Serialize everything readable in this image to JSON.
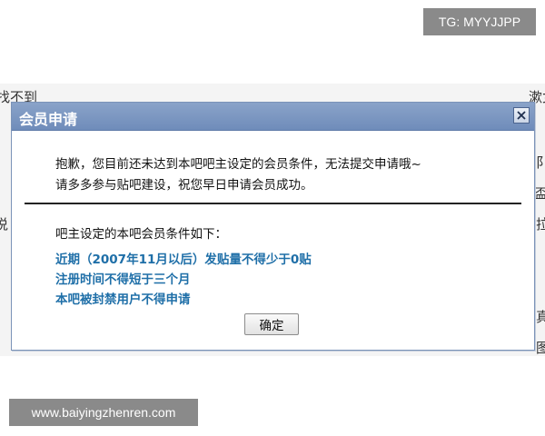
{
  "background": {
    "left_top_text": "找不到",
    "left_mid_text": "说",
    "right_top_text": "漱女",
    "right_fragments": [
      "阝",
      "盃",
      "拉",
      "真",
      "图"
    ]
  },
  "dialog": {
    "title": "会员申请",
    "close_glyph": "✕",
    "message_line1": "抱歉，您目前还未达到本吧吧主设定的会员条件，无法提交申请哦~",
    "message_line2": "请多多参与贴吧建设，祝您早日申请会员成功。",
    "conditions_title": "吧主设定的本吧会员条件如下：",
    "conditions": [
      "近期（2007年11月以后）发贴量不得少于0贴",
      "注册时间不得短于三个月",
      "本吧被封禁用户不得申请"
    ],
    "ok_label": "确定",
    "accent_color": "#1f6fa8",
    "titlebar_color": "#7d97c2"
  },
  "watermarks": {
    "top_right": "TG: MYYJJPP",
    "bottom_left": "www.baiyingzhenren.com"
  }
}
